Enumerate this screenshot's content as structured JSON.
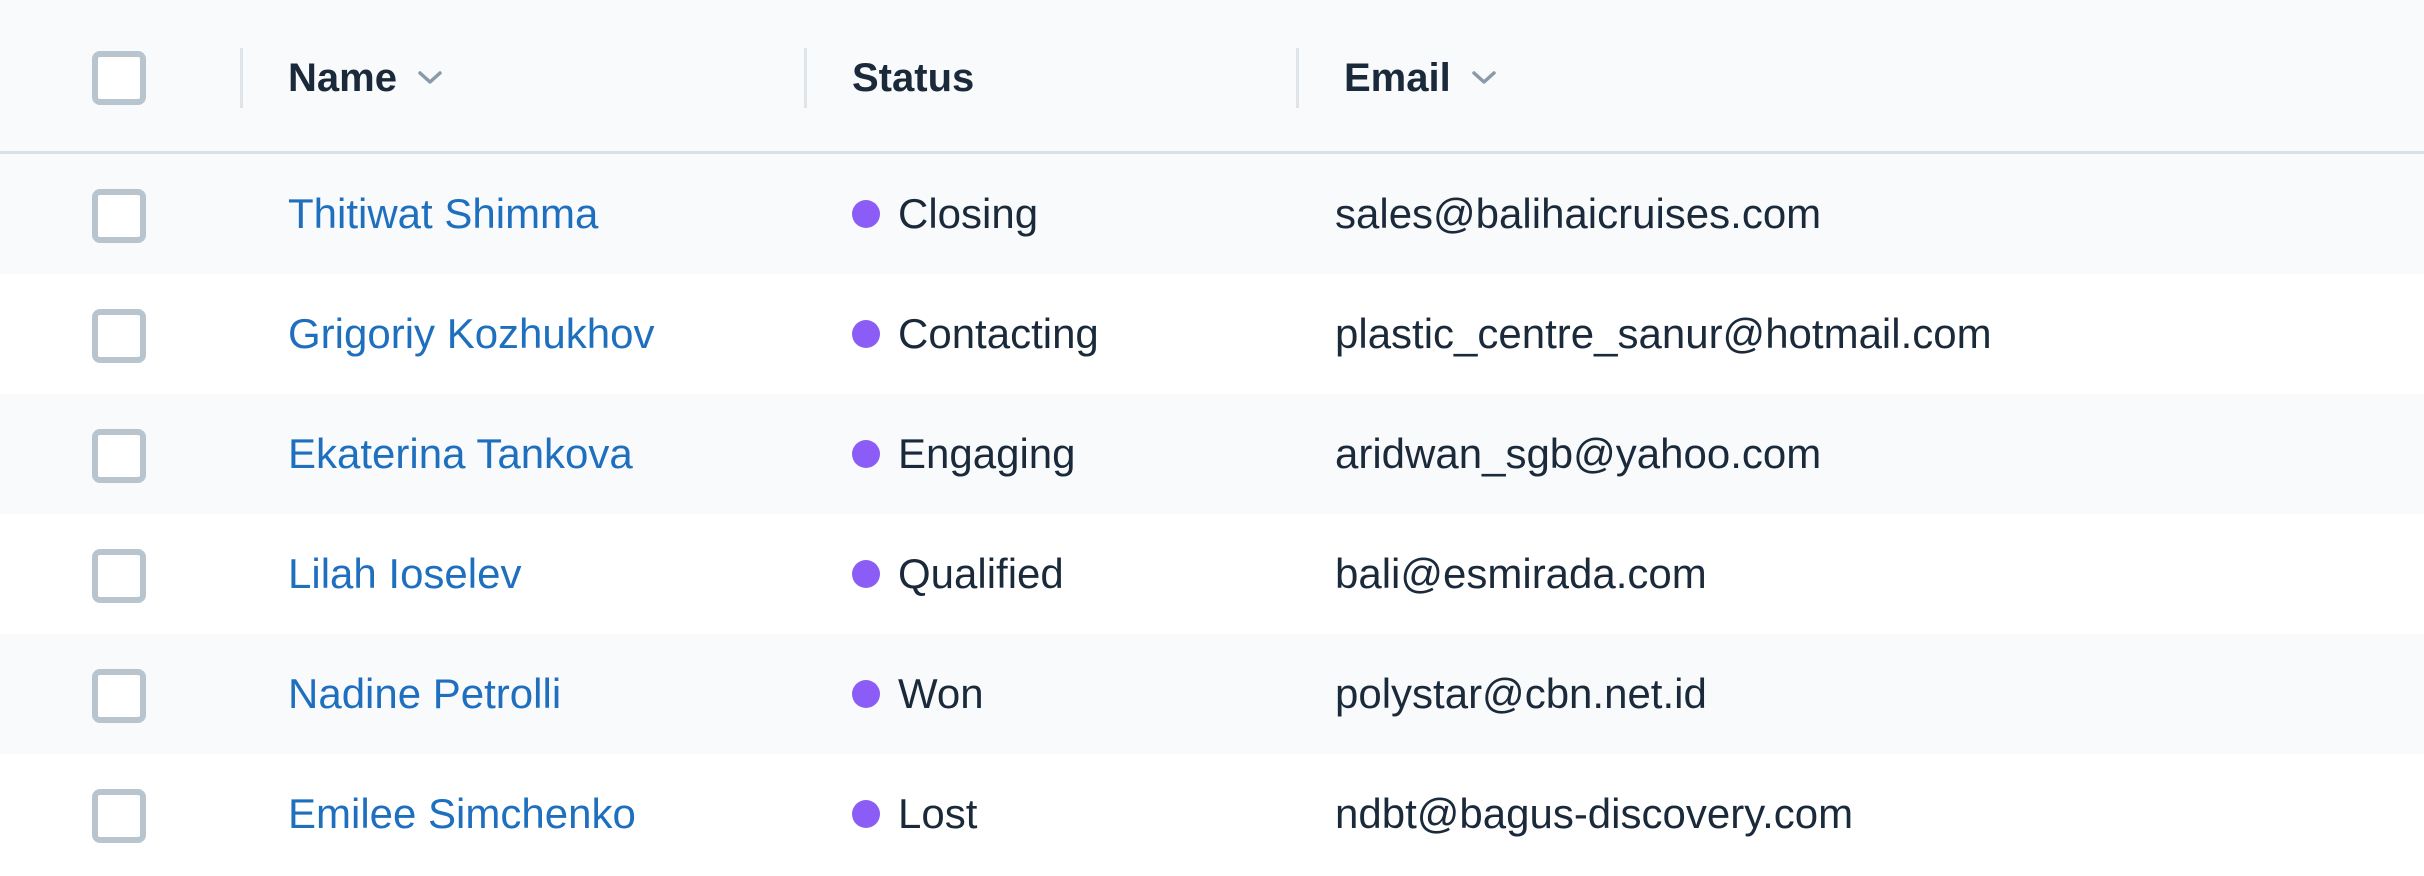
{
  "header": {
    "columns": [
      {
        "label": "Name",
        "sortable": true
      },
      {
        "label": "Status",
        "sortable": false
      },
      {
        "label": "Email",
        "sortable": true
      }
    ]
  },
  "colors": {
    "status_dot": "#8b5cf6",
    "name_link": "#1f6fbf",
    "text": "#1b2a3b",
    "checkbox_border": "#b9c5ce",
    "header_bg": "#f8fafc"
  },
  "rows": [
    {
      "name": "Thitiwat Shimma",
      "status": "Closing",
      "email": "sales@balihaicruises.com"
    },
    {
      "name": "Grigoriy Kozhukhov",
      "status": "Contacting",
      "email": "plastic_centre_sanur@hotmail.com"
    },
    {
      "name": "Ekaterina Tankova",
      "status": "Engaging",
      "email": "aridwan_sgb@yahoo.com"
    },
    {
      "name": "Lilah Ioselev",
      "status": "Qualified",
      "email": "bali@esmirada.com"
    },
    {
      "name": "Nadine Petrolli",
      "status": "Won",
      "email": "polystar@cbn.net.id"
    },
    {
      "name": "Emilee Simchenko",
      "status": "Lost",
      "email": "ndbt@bagus-discovery.com"
    }
  ]
}
